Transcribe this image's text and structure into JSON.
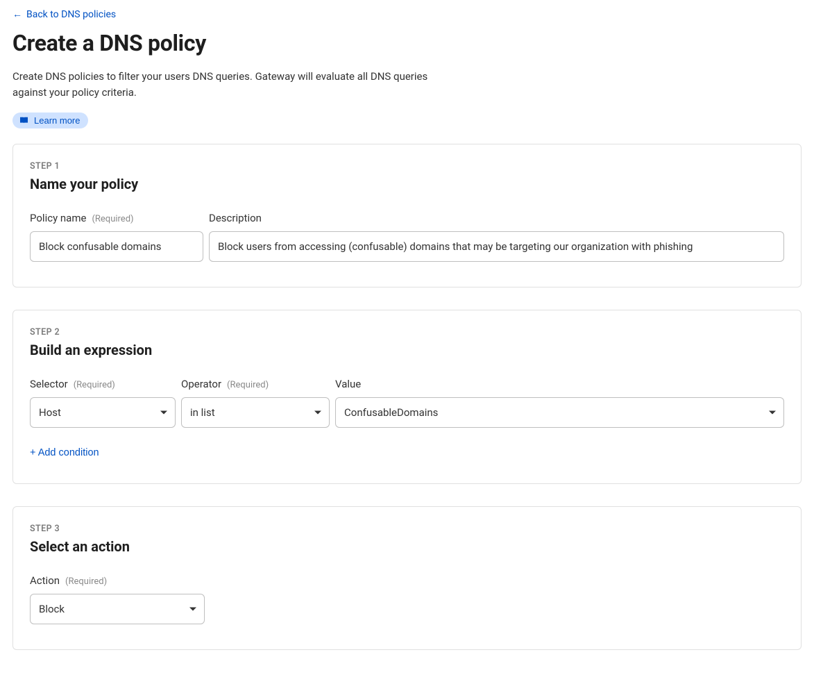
{
  "nav": {
    "back_label": "Back to DNS policies"
  },
  "header": {
    "title": "Create a DNS policy",
    "description": "Create DNS policies to filter your users DNS queries. Gateway will evaluate all DNS queries against your policy criteria.",
    "learn_more_label": "Learn more"
  },
  "common": {
    "required_hint": "(Required)"
  },
  "step1": {
    "step_label": "STEP 1",
    "heading": "Name your policy",
    "policy_name_label": "Policy name",
    "policy_name_value": "Block confusable domains",
    "description_label": "Description",
    "description_value": "Block users from accessing (confusable) domains that may be targeting our organization with phishing"
  },
  "step2": {
    "step_label": "STEP 2",
    "heading": "Build an expression",
    "selector_label": "Selector",
    "selector_value": "Host",
    "operator_label": "Operator",
    "operator_value": "in list",
    "value_label": "Value",
    "value_value": "ConfusableDomains",
    "add_condition_label": "+ Add condition"
  },
  "step3": {
    "step_label": "STEP 3",
    "heading": "Select an action",
    "action_label": "Action",
    "action_value": "Block"
  }
}
